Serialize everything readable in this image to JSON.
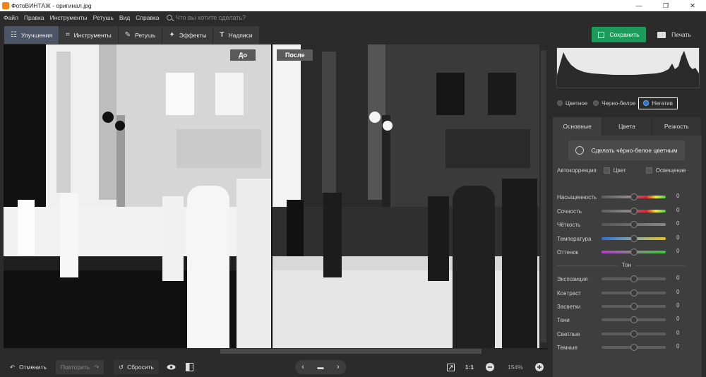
{
  "window": {
    "title": "ФотоВИНТАЖ - оригинал.jpg",
    "controls": [
      "—",
      "❐",
      "✕"
    ]
  },
  "menu": {
    "items": [
      "Файл",
      "Правка",
      "Инструменты",
      "Ретушь",
      "Вид",
      "Справка"
    ],
    "search_placeholder": "Что вы хотите сделать?"
  },
  "toolbar": {
    "tabs": [
      {
        "label": "Улучшения",
        "icon": "sliders-icon",
        "glyph": "☷"
      },
      {
        "label": "Инструменты",
        "icon": "crop-icon",
        "glyph": "⌗"
      },
      {
        "label": "Ретушь",
        "icon": "brush-icon",
        "glyph": "✎"
      },
      {
        "label": "Эффекты",
        "icon": "magic-wand-icon",
        "glyph": "✦"
      },
      {
        "label": "Надписи",
        "icon": "text-icon",
        "glyph": "T"
      }
    ],
    "save_label": "Сохранить",
    "print_label": "Печать"
  },
  "main": {
    "before_label": "До",
    "after_label": "После",
    "before_image": "negative photo",
    "after_image": "restored photo"
  },
  "bottom": {
    "undo": "Отменить",
    "redo": "Повторить",
    "reset": "Сбросить",
    "ratio": "1:1",
    "zoom": "154%"
  },
  "panel": {
    "modes": [
      "Цветное",
      "Черно-белое",
      "Негатив"
    ],
    "selected_mode": "Негатив",
    "subtabs": [
      "Основные",
      "Цвета",
      "Резкость"
    ],
    "colorize_button": "Сделать чёрно-белое цветным",
    "autocorrection": {
      "label": "Автокоррекция",
      "opt1": "Цвет",
      "opt2": "Освещение"
    },
    "sliders_top": [
      {
        "label": "Насыщенность",
        "value": "0"
      },
      {
        "label": "Сочность",
        "value": "0"
      },
      {
        "label": "Чёткость",
        "value": "0"
      },
      {
        "label": "Температура",
        "value": "0"
      },
      {
        "label": "Оттенок",
        "value": "0"
      }
    ],
    "ton_label": "Тон",
    "sliders_bottom": [
      {
        "label": "Экспозиция",
        "value": "0"
      },
      {
        "label": "Контраст",
        "value": "0"
      },
      {
        "label": "Засветки",
        "value": "0"
      },
      {
        "label": "Тени",
        "value": "0"
      },
      {
        "label": "Светлые",
        "value": "0"
      },
      {
        "label": "Темные",
        "value": "0"
      }
    ]
  },
  "colors": {
    "accent_save": "#1c9a5a",
    "active_tab": "#4b5566",
    "radio_selected": "#1e6fd0"
  }
}
